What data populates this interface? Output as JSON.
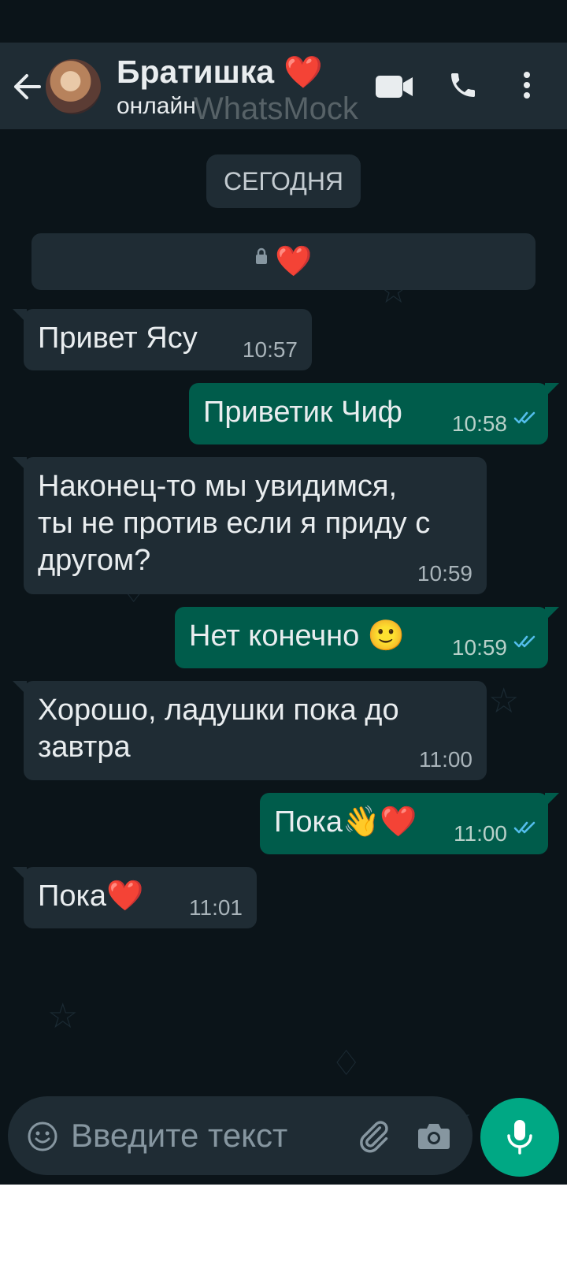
{
  "header": {
    "contact_name": "Братишка",
    "name_emoji": "❤️",
    "status": "онлайн",
    "watermark": "WhatsMock"
  },
  "chat": {
    "date_label": "СЕГОДНЯ",
    "banner_emoji": "❤️",
    "messages": [
      {
        "dir": "in",
        "text": "Привет Ясу",
        "time": "10:57"
      },
      {
        "dir": "out",
        "text": "Приветик Чиф",
        "time": "10:58",
        "read": true
      },
      {
        "dir": "in",
        "text": "Наконец-то мы увидимся,\nты не против если я приду с\nдругом?",
        "time": "10:59"
      },
      {
        "dir": "out",
        "text": "Нет конечно",
        "emoji": "🙂",
        "time": "10:59",
        "read": true
      },
      {
        "dir": "in",
        "text": "Хорошо, ладушки пока до\nзавтра",
        "time": "11:00"
      },
      {
        "dir": "out",
        "text": "Пока",
        "emoji": "👋❤️",
        "time": "11:00",
        "read": true
      },
      {
        "dir": "in",
        "text": "Пока",
        "emoji": "❤️",
        "time": "11:01"
      }
    ]
  },
  "composer": {
    "placeholder": "Введите текст"
  },
  "colors": {
    "background": "#0b1419",
    "header": "#1f2c34",
    "incoming_bubble": "#1f2c34",
    "outgoing_bubble": "#005c4b",
    "read_ticks": "#53bdeb",
    "mic_button": "#00a884"
  },
  "icons": [
    "back-arrow-icon",
    "video-call-icon",
    "voice-call-icon",
    "more-vert-icon",
    "lock-icon",
    "double-check-icon",
    "emoji-icon",
    "attach-icon",
    "camera-icon",
    "mic-icon"
  ]
}
